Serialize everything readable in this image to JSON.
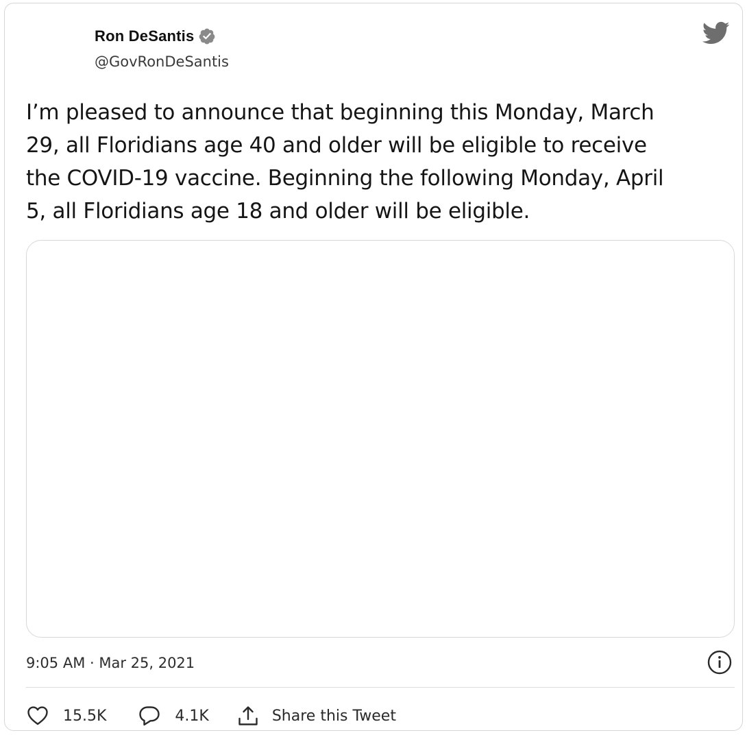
{
  "tweet": {
    "author": {
      "display_name": "Ron DeSantis",
      "handle": "@GovRonDeSantis",
      "verified_icon": "verified-badge-icon"
    },
    "brand_icon": "twitter-bird-icon",
    "text": "I’m pleased to announce that beginning this Monday, March\n29, all Floridians age 40 and older will be eligible to receive\nthe COVID-19 vaccine. Beginning the following Monday, April\n5, all Floridians age 18 and older will be eligible.",
    "timestamp": "9:05 AM · Mar 25, 2021",
    "info_icon": "info-icon",
    "actions": {
      "likes": "15.5K",
      "replies": "4.1K",
      "share_label": "Share this Tweet"
    }
  },
  "colors": {
    "text": "#151515",
    "secondary_text": "#3a3a3a",
    "border": "#d8d8d8",
    "badge": "#8a8a8a"
  }
}
